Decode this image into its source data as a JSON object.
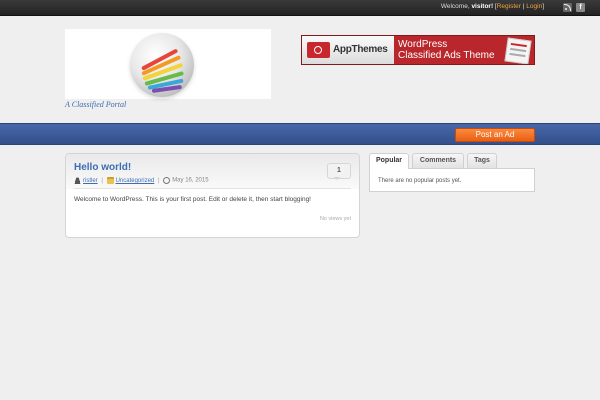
{
  "topbar": {
    "welcome_prefix": "Welcome,",
    "username": "visitor!",
    "open_bracket": "[",
    "register_label": "Register",
    "pipe": "|",
    "login_label": "Login",
    "close_bracket": "]",
    "facebook_glyph": "f"
  },
  "header": {
    "tagline": "A Classified Portal",
    "banner": {
      "brand": "AppThemes",
      "promo_line1": "WordPress",
      "promo_line2": "Classified Ads Theme"
    }
  },
  "nav": {
    "post_ad_label": "Post an Ad"
  },
  "post": {
    "title": "Hello world!",
    "comment_count": "1",
    "author": "ristler",
    "category": "Uncategorized",
    "date": "May 16, 2015",
    "meta_sep": "|",
    "body": "Welcome to WordPress. This is your first post. Edit or delete it, then start blogging!",
    "views": "No views yet"
  },
  "sidebar": {
    "tabs": [
      {
        "label": "Popular"
      },
      {
        "label": "Comments"
      },
      {
        "label": "Tags"
      }
    ],
    "active_tab": "Popular",
    "empty_message": "There are no popular posts yet."
  },
  "colors": {
    "nav_blue": "#3f5e9f",
    "post_button_orange": "#f27430",
    "link_blue": "#3e6db3",
    "topbar_dark": "#2b2b2b",
    "banner_red": "#b9262b"
  },
  "icons": [
    "rss-icon",
    "facebook-icon",
    "user-icon",
    "folder-icon",
    "clock-icon",
    "globe-logo",
    "comment-bubble-icon"
  ]
}
